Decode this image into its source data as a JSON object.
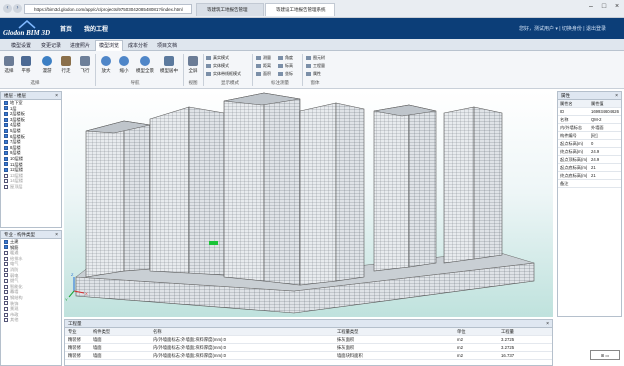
{
  "browser": {
    "address": "https://bim3d.glodon.com/app/c/c/projects/9750304208548081?/index.html",
    "tabs": [
      "等建筑工地报告管理",
      "等建设工地报告管理系统"
    ],
    "nav_icons": [
      "back-icon",
      "forward-icon"
    ]
  },
  "header": {
    "logo_line1": "Glodon BIM 3D",
    "nav": [
      "首页",
      "我的工程"
    ],
    "user": "您好，测试用户 ▾ | 切换身份 | 退出登录"
  },
  "menu": [
    "模型设置",
    "变更记录",
    "进度照片",
    "模型浏览",
    "成本分析",
    "项目文档"
  ],
  "ribbon": {
    "group1_buttons": [
      "选择",
      "平移",
      "漫游",
      "行走",
      "飞行"
    ],
    "group1_label": "选择",
    "group2_buttons": [
      "放大",
      "缩小",
      "模型全景",
      "模型居中"
    ],
    "group2_label": "导航",
    "group3_buttons": [
      "全屏"
    ],
    "group3_label": "视图",
    "group4_items": [
      "真实模式",
      "实体模式",
      "实体带线框模式"
    ],
    "group4_label": "显示模式",
    "group5_items": [
      "测量",
      "距离",
      "面积",
      "角度",
      "标高",
      "坐标"
    ],
    "group5_label": "标注测量",
    "group6_items": [
      "图元树",
      "工程量",
      "属性"
    ],
    "group6_label": "窗体"
  },
  "floor_panel": {
    "title": "楼层 - 楼层",
    "items": [
      {
        "label": "地下室",
        "on": true
      },
      {
        "label": "1层",
        "on": true
      },
      {
        "label": "2层楼板",
        "on": true
      },
      {
        "label": "3层楼板",
        "on": true
      },
      {
        "label": "4层楼",
        "on": true
      },
      {
        "label": "5层楼",
        "on": true
      },
      {
        "label": "6层楼板",
        "on": true
      },
      {
        "label": "7层楼",
        "on": true
      },
      {
        "label": "8层楼",
        "on": true
      },
      {
        "label": "9层楼",
        "on": true
      },
      {
        "label": "10层楼",
        "on": true
      },
      {
        "label": "11层楼",
        "on": true
      },
      {
        "label": "12层楼",
        "on": true
      },
      {
        "label": "13层楼",
        "on": false
      },
      {
        "label": "14层楼",
        "on": false
      },
      {
        "label": "屋顶层",
        "on": false
      }
    ]
  },
  "type_panel": {
    "title": "专业 - 构件类型",
    "items": [
      {
        "label": "土建",
        "on": true
      },
      {
        "label": "钢筋",
        "on": true
      },
      {
        "label": "暖通",
        "on": false
      },
      {
        "label": "给排水",
        "on": false
      },
      {
        "label": "电气",
        "on": false
      },
      {
        "label": "消防",
        "on": false
      },
      {
        "label": "弱电",
        "on": false
      },
      {
        "label": "燃气",
        "on": false
      },
      {
        "label": "智能化",
        "on": false
      },
      {
        "label": "幕墙",
        "on": false
      },
      {
        "label": "钢结构",
        "on": false
      },
      {
        "label": "装饰",
        "on": false
      },
      {
        "label": "景观",
        "on": false
      },
      {
        "label": "市政",
        "on": false
      },
      {
        "label": "其他",
        "on": false
      }
    ]
  },
  "props_panel": {
    "title": "属性",
    "header": [
      "属性名",
      "属性值"
    ],
    "rows": [
      [
        "ID",
        "169934604626"
      ],
      [
        "名称",
        "QM-2"
      ],
      [
        "内/外墙标志",
        "外墙面"
      ],
      [
        "构件编号",
        "[砼]"
      ],
      [
        "起点标高(m)",
        "0"
      ],
      [
        "终点标高(m)",
        "24.9"
      ],
      [
        "起点顶标高(m)",
        "24.9"
      ],
      [
        "起点底标高(m)",
        "21"
      ],
      [
        "终点底标高(m)",
        "21"
      ],
      [
        "备注",
        ""
      ]
    ]
  },
  "quantity_panel": {
    "title": "工程量",
    "header": [
      "专业",
      "构件类型",
      "名称",
      "工程量类型",
      "单位",
      "工程量"
    ],
    "rows": [
      [
        "精装修",
        "墙面",
        "内/外墙面标志:外墙面;块料厚度(mm):0",
        "抹灰面积",
        "m2",
        "3.2725"
      ],
      [
        "精装修",
        "墙面",
        "内/外墙面标志:外墙面;块料厚度(mm):0",
        "抹灰面积",
        "m2",
        "3.2725"
      ],
      [
        "精装修",
        "墙面",
        "内/外墙面标志:外墙面;块料厚度(mm):0",
        "墙面块料面积",
        "m2",
        "16.737"
      ]
    ]
  },
  "viewport": {
    "axis_labels": [
      "Z",
      "X",
      "Y"
    ]
  },
  "colors": {
    "header": "#0c3e78",
    "accent": "#3a7bd5",
    "highlight": "#19c437"
  }
}
